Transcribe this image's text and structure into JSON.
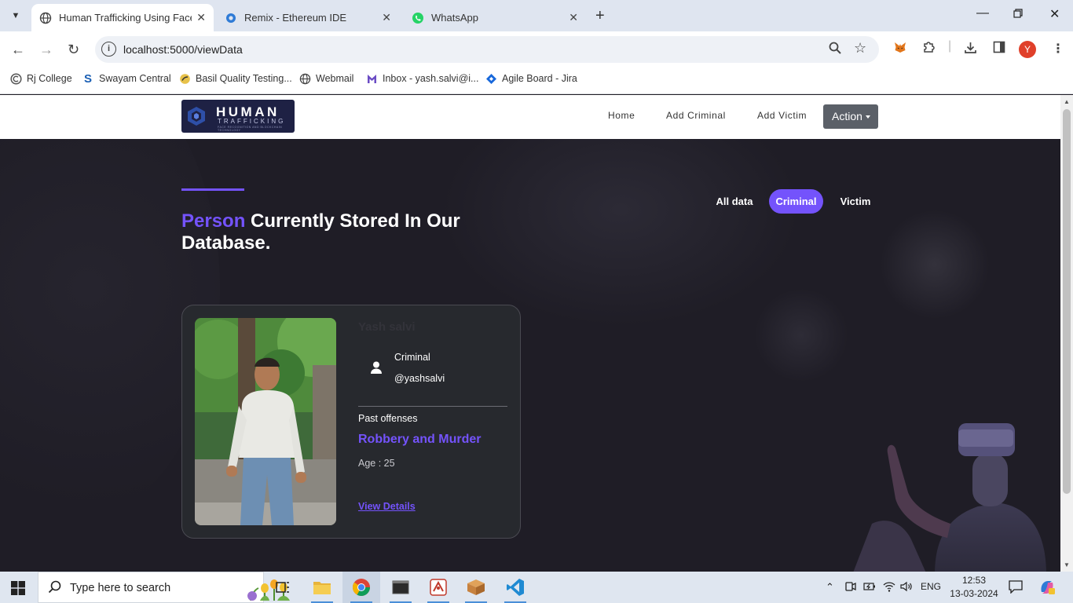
{
  "browser": {
    "tabs": [
      {
        "title": "Human Trafficking Using Face R",
        "active": true
      },
      {
        "title": "Remix - Ethereum IDE",
        "active": false
      },
      {
        "title": "WhatsApp",
        "active": false
      }
    ],
    "url": "localhost:5000/viewData",
    "bookmarks": [
      {
        "label": "Rj College",
        "icon": "rj-college-icon"
      },
      {
        "label": "Swayam Central",
        "icon": "swayam-icon"
      },
      {
        "label": "Basil Quality Testing...",
        "icon": "basil-icon"
      },
      {
        "label": "Webmail",
        "icon": "globe-icon"
      },
      {
        "label": "Inbox - yash.salvi@i...",
        "icon": "mail-icon"
      },
      {
        "label": "Agile Board - Jira",
        "icon": "jira-icon"
      }
    ],
    "profile_initial": "Y"
  },
  "site": {
    "logo": {
      "line1": "HUMAN",
      "line2": "TRAFFICKING",
      "tagline": "FACE RECOGNITION AND BLOCKCHAIN TECHNOLOGY"
    },
    "nav": {
      "home": "Home",
      "add_criminal": "Add Criminal",
      "add_victim": "Add Victim",
      "action": "Action"
    }
  },
  "hero": {
    "heading_highlight": "Person",
    "heading_rest": " Currently Stored In Our Database.",
    "filters": {
      "all": "All data",
      "criminal": "Criminal",
      "victim": "Victim"
    },
    "active_filter": "Criminal"
  },
  "card": {
    "name": "Yash salvi",
    "role": "Criminal",
    "handle": "@yashsalvi",
    "offense_label": "Past offenses",
    "offense": "Robbery and Murder",
    "age": "Age : 25",
    "details_link": "View Details"
  },
  "taskbar": {
    "search_placeholder": "Type here to search",
    "lang": "ENG",
    "time": "12:53",
    "date": "13-03-2024"
  },
  "colors": {
    "accent": "#7453fc",
    "page_bg": "#1f1d26",
    "card_bg": "#27292e"
  }
}
